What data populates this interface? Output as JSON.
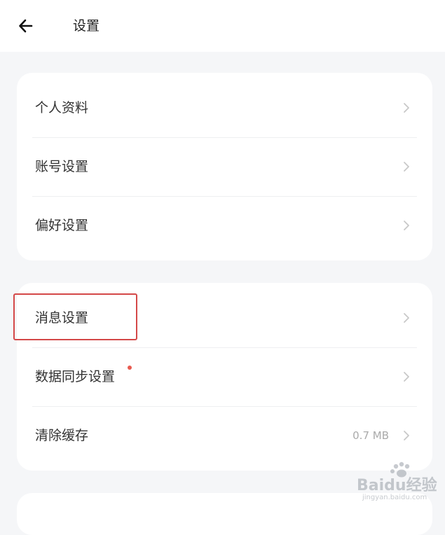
{
  "header": {
    "title": "设置",
    "back_icon": "arrow-left-icon"
  },
  "groups": [
    {
      "items": [
        {
          "label": "个人资料",
          "icon": "chevron-right-icon"
        },
        {
          "label": "账号设置",
          "icon": "chevron-right-icon"
        },
        {
          "label": "偏好设置",
          "icon": "chevron-right-icon"
        }
      ]
    },
    {
      "items": [
        {
          "label": "消息设置",
          "icon": "chevron-right-icon",
          "highlighted": true
        },
        {
          "label": "数据同步设置",
          "icon": "chevron-right-icon",
          "badge_dot": true
        },
        {
          "label": "清除缓存",
          "value": "0.7 MB",
          "icon": "chevron-right-icon"
        }
      ]
    }
  ],
  "colors": {
    "background": "#f5f6f8",
    "card": "#ffffff",
    "highlight": "#d44848",
    "badge_dot": "#e85a4f",
    "chevron": "#c8c8c8"
  },
  "watermark": {
    "text": "Baidu经验",
    "url": "jingyan.baidu.com"
  }
}
